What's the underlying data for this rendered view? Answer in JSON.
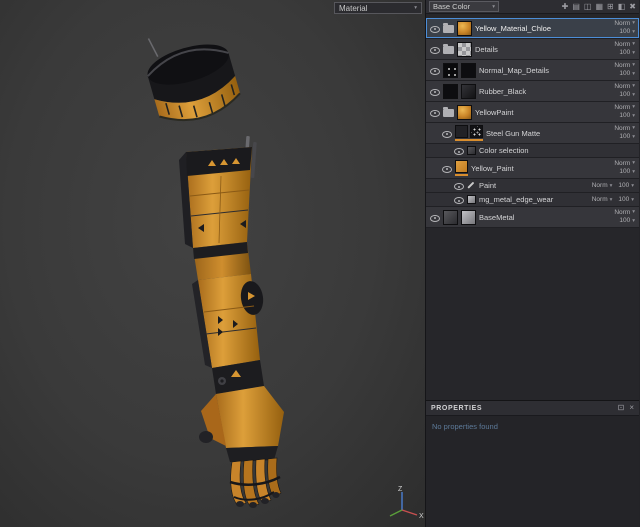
{
  "viewport": {
    "shading_mode": "Material",
    "gizmo": {
      "z_label": "Z",
      "x_label": "X"
    },
    "colors": {
      "armor_orange": "#cf8a2e",
      "armor_black": "#17171a",
      "background": "#3a3a3a"
    }
  },
  "layers_panel": {
    "channel": "Base Color",
    "toolbar_icons": [
      {
        "name": "add-effect-icon",
        "glyph": "✚"
      },
      {
        "name": "paint-layer-icon",
        "glyph": "▤"
      },
      {
        "name": "fill-layer-icon",
        "glyph": "◫"
      },
      {
        "name": "smart-material-icon",
        "glyph": "▦"
      },
      {
        "name": "add-folder-icon",
        "glyph": "⊞"
      },
      {
        "name": "add-mask-icon",
        "glyph": "◧"
      },
      {
        "name": "delete-layer-icon",
        "glyph": "✖"
      }
    ],
    "layers": [
      {
        "name": "Yellow_Material_Chloe",
        "blend": "Norm",
        "opacity": "100"
      },
      {
        "name": "Details",
        "blend": "Norm",
        "opacity": "100"
      },
      {
        "name": "Normal_Map_Details",
        "blend": "Norm",
        "opacity": "100"
      },
      {
        "name": "Rubber_Black",
        "blend": "Norm",
        "opacity": "100"
      },
      {
        "name": "YellowPaint",
        "blend": "Norm",
        "opacity": "100"
      },
      {
        "name": "Steel Gun Matte",
        "blend": "Norm",
        "opacity": "100"
      },
      {
        "name": "Color selection"
      },
      {
        "name": "Yellow_Paint",
        "blend": "Norm",
        "opacity": "100"
      },
      {
        "name": "Paint",
        "blend": "Norm",
        "opacity": "100"
      },
      {
        "name": "mg_metal_edge_wear",
        "blend": "Norm",
        "opacity": "100"
      },
      {
        "name": "BaseMetal",
        "blend": "Norm",
        "opacity": "100"
      }
    ],
    "colors": {
      "selection_blue": "#4c8ed8",
      "fill_strip_orange": "#d98e2e"
    }
  },
  "properties": {
    "title": "PROPERTIES",
    "empty_text": "No properties found",
    "icons": [
      {
        "name": "panel-float-icon",
        "glyph": "⊡"
      },
      {
        "name": "panel-close-icon",
        "glyph": "×"
      }
    ]
  }
}
